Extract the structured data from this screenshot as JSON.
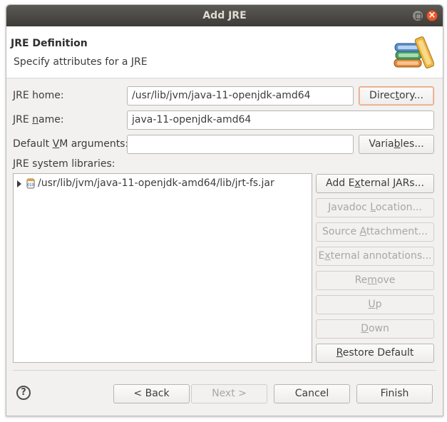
{
  "window": {
    "title": "Add JRE"
  },
  "header": {
    "title": "JRE Definition",
    "subtitle": "Specify attributes for a JRE",
    "icon": "books-icon"
  },
  "form": {
    "jre_home": {
      "label_pre": "",
      "label_u": "J",
      "label_post": "RE home:",
      "value": "/usr/lib/jvm/java-11-openjdk-amd64"
    },
    "directory_button": {
      "pre": "Direc",
      "u": "t",
      "post": "ory..."
    },
    "jre_name": {
      "label_pre": "JRE ",
      "label_u": "n",
      "label_post": "ame:",
      "value": "java-11-openjdk-amd64"
    },
    "vm_args": {
      "label_pre": "Default ",
      "label_u": "V",
      "label_post": "M arguments:",
      "value": ""
    },
    "variables_button": {
      "pre": "Varia",
      "u": "b",
      "post": "les..."
    },
    "libraries_label": "JRE system libraries:"
  },
  "libraries": [
    {
      "path": "/usr/lib/jvm/java-11-openjdk-amd64/lib/jrt-fs.jar",
      "icon": "jar-icon",
      "expanded": false
    }
  ],
  "side_buttons": {
    "add_external_jars": {
      "pre": "Add E",
      "u": "x",
      "post": "ternal JARs...",
      "enabled": true
    },
    "javadoc_location": {
      "pre": "Javadoc ",
      "u": "L",
      "post": "ocation...",
      "enabled": false
    },
    "source_attachment": {
      "pre": "Source ",
      "u": "A",
      "post": "ttachment...",
      "enabled": false
    },
    "external_annotations": {
      "pre": "E",
      "u": "x",
      "post": "ternal annotations...",
      "enabled": false
    },
    "remove": {
      "pre": "Re",
      "u": "m",
      "post": "ove",
      "enabled": false
    },
    "up": {
      "pre": "",
      "u": "U",
      "post": "p",
      "enabled": false
    },
    "down": {
      "pre": "",
      "u": "D",
      "post": "own",
      "enabled": false
    },
    "restore_default": {
      "pre": "",
      "u": "R",
      "post": "estore Default",
      "enabled": true
    }
  },
  "footer": {
    "help": "?",
    "back": "< Back",
    "next": "Next >",
    "cancel": "Cancel",
    "finish": "Finish"
  },
  "colors": {
    "titlebar": "#3d3c38",
    "close_button": "#e65a2c",
    "dialog_bg": "#f2f1f0",
    "focus_border": "#e9a27c",
    "disabled_text": "#a8a7a3"
  }
}
